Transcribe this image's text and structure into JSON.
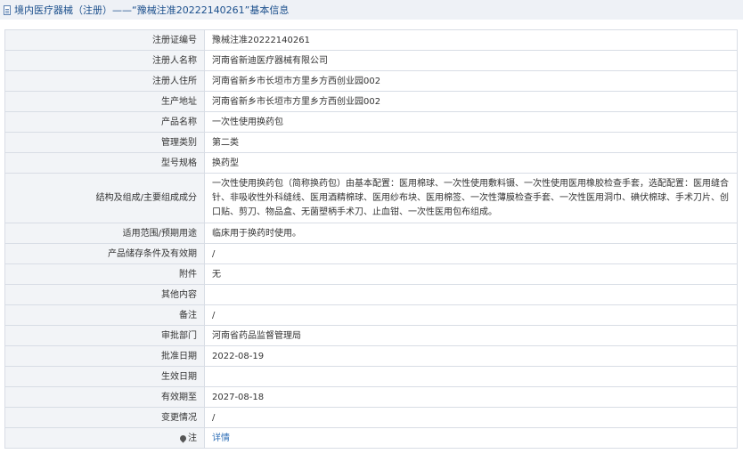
{
  "header": {
    "title": "境内医疗器械（注册）——“豫械注准20222140261”基本信息"
  },
  "rows": [
    {
      "label": "注册证编号",
      "value": "豫械注准20222140261"
    },
    {
      "label": "注册人名称",
      "value": "河南省新迪医疗器械有限公司"
    },
    {
      "label": "注册人住所",
      "value": "河南省新乡市长垣市方里乡方西创业园002"
    },
    {
      "label": "生产地址",
      "value": "河南省新乡市长垣市方里乡方西创业园002"
    },
    {
      "label": "产品名称",
      "value": "一次性使用换药包"
    },
    {
      "label": "管理类别",
      "value": "第二类"
    },
    {
      "label": "型号规格",
      "value": "换药型"
    },
    {
      "label": "结构及组成/主要组成成分",
      "value": "一次性使用换药包（简称换药包）由基本配置：医用棉球、一次性使用敷料镊、一次性使用医用橡胶检查手套，选配配置：医用缝合针、非吸收性外科缝线、医用酒精棉球、医用纱布块、医用棉签、一次性薄膜检查手套、一次性医用洞巾、碘伏棉球、手术刀片、创口贴、剪刀、物品盒、无菌塑柄手术刀、止血钳、一次性医用包布组成。"
    },
    {
      "label": "适用范围/预期用途",
      "value": "临床用于换药时使用。"
    },
    {
      "label": "产品储存条件及有效期",
      "value": "/"
    },
    {
      "label": "附件",
      "value": "无"
    },
    {
      "label": "其他内容",
      "value": ""
    },
    {
      "label": "备注",
      "value": "/"
    },
    {
      "label": "审批部门",
      "value": "河南省药品监督管理局"
    },
    {
      "label": "批准日期",
      "value": "2022-08-19"
    },
    {
      "label": "生效日期",
      "value": ""
    },
    {
      "label": "有效期至",
      "value": "2027-08-18"
    },
    {
      "label": "变更情况",
      "value": "/"
    }
  ],
  "note": {
    "label": "注",
    "icon": "pin-icon",
    "link_text": "详情"
  }
}
